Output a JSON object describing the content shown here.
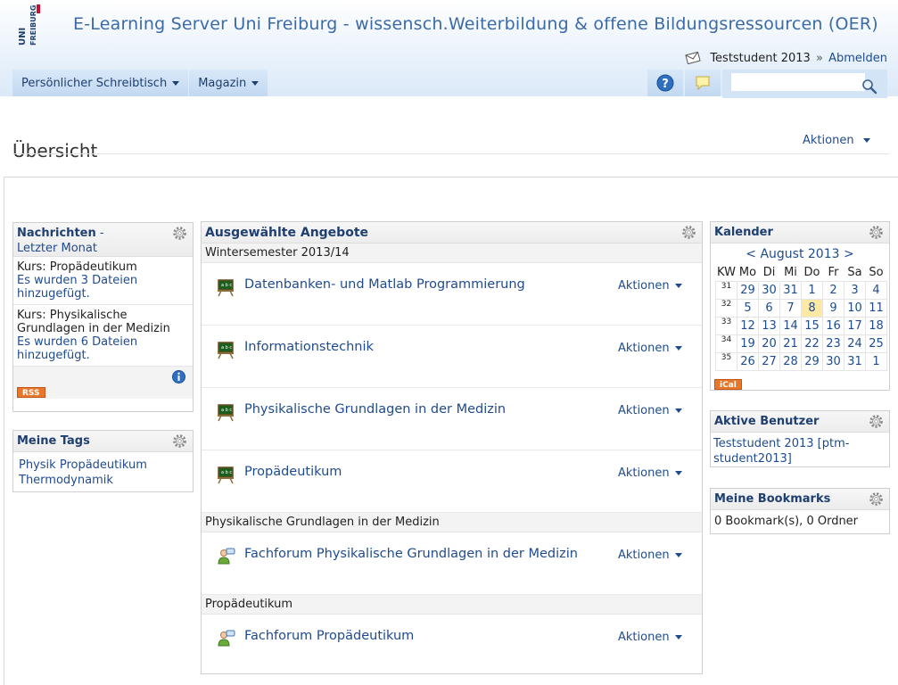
{
  "header": {
    "site_title": "E-Learning Server Uni Freiburg - wissensch.Weiterbildung & offene Bildungsressourcen (OER)",
    "logo_text_1": "UNI",
    "logo_text_2": "FREIBURG",
    "user_name": "Teststudent 2013",
    "separator": "»",
    "logout_label": "Abmelden"
  },
  "mainbar": {
    "tabs": [
      {
        "label": "Persönlicher Schreibtisch"
      },
      {
        "label": "Magazin"
      }
    ],
    "search_value": ""
  },
  "page": {
    "title": "Übersicht",
    "actions_label": "Aktionen"
  },
  "news": {
    "title": "Nachrichten",
    "title_tail": "Letzter Monat",
    "title_dash": " - ",
    "items": [
      {
        "course": "Kurs: Propädeutikum",
        "text": "Es wurden 3 Dateien hinzugefügt."
      },
      {
        "course": "Kurs: Physikalische Grundlagen in der Medizin",
        "text": "Es wurden 6 Dateien hinzugefügt."
      }
    ],
    "rss_label": "RSS"
  },
  "tags": {
    "title": "Meine Tags",
    "items": [
      "Physik",
      "Propädeutikum",
      "Thermodynamik"
    ]
  },
  "selected": {
    "title": "Ausgewählte Angebote",
    "groups": [
      {
        "label": "Wintersemester 2013/14",
        "items": [
          {
            "title": "Datenbanken- und Matlab Programmierung",
            "actions": "Aktionen",
            "icon": "course-icon"
          },
          {
            "title": "Informationstechnik",
            "actions": "Aktionen",
            "icon": "course-icon"
          },
          {
            "title": "Physikalische Grundlagen in der Medizin",
            "actions": "Aktionen",
            "icon": "course-icon"
          },
          {
            "title": "Propädeutikum",
            "actions": "Aktionen",
            "icon": "course-icon"
          }
        ]
      },
      {
        "label": "Physikalische Grundlagen in der Medizin",
        "items": [
          {
            "title": "Fachforum Physikalische Grundlagen in der Medizin",
            "actions": "Aktionen",
            "icon": "forum-icon"
          }
        ]
      },
      {
        "label": "Propädeutikum",
        "items": [
          {
            "title": "Fachforum Propädeutikum",
            "actions": "Aktionen",
            "icon": "forum-icon"
          }
        ]
      }
    ]
  },
  "calendar": {
    "title": "Kalender",
    "prev": "<",
    "month": "August 2013",
    "next": ">",
    "headers": [
      "KW",
      "Mo",
      "Di",
      "Mi",
      "Do",
      "Fr",
      "Sa",
      "So"
    ],
    "weeks": [
      {
        "kw": "31",
        "days": [
          "29",
          "30",
          "31",
          "1",
          "2",
          "3",
          "4"
        ]
      },
      {
        "kw": "32",
        "days": [
          "5",
          "6",
          "7",
          "8",
          "9",
          "10",
          "11"
        ]
      },
      {
        "kw": "33",
        "days": [
          "12",
          "13",
          "14",
          "15",
          "16",
          "17",
          "18"
        ]
      },
      {
        "kw": "34",
        "days": [
          "19",
          "20",
          "21",
          "22",
          "23",
          "24",
          "25"
        ]
      },
      {
        "kw": "35",
        "days": [
          "26",
          "27",
          "28",
          "29",
          "30",
          "31",
          "1"
        ]
      }
    ],
    "today": "8",
    "ical_label": "iCal",
    "today_color": "#fde9a4"
  },
  "active_users": {
    "title": "Aktive Benutzer",
    "text": "Teststudent 2013 [ptm-student2013]"
  },
  "bookmarks": {
    "title": "Meine Bookmarks",
    "text": "0 Bookmark(s), 0 Ordner"
  },
  "colors": {
    "link": "#1f4b8e",
    "accent": "#3a6aa8",
    "rss": "#e9772a"
  }
}
